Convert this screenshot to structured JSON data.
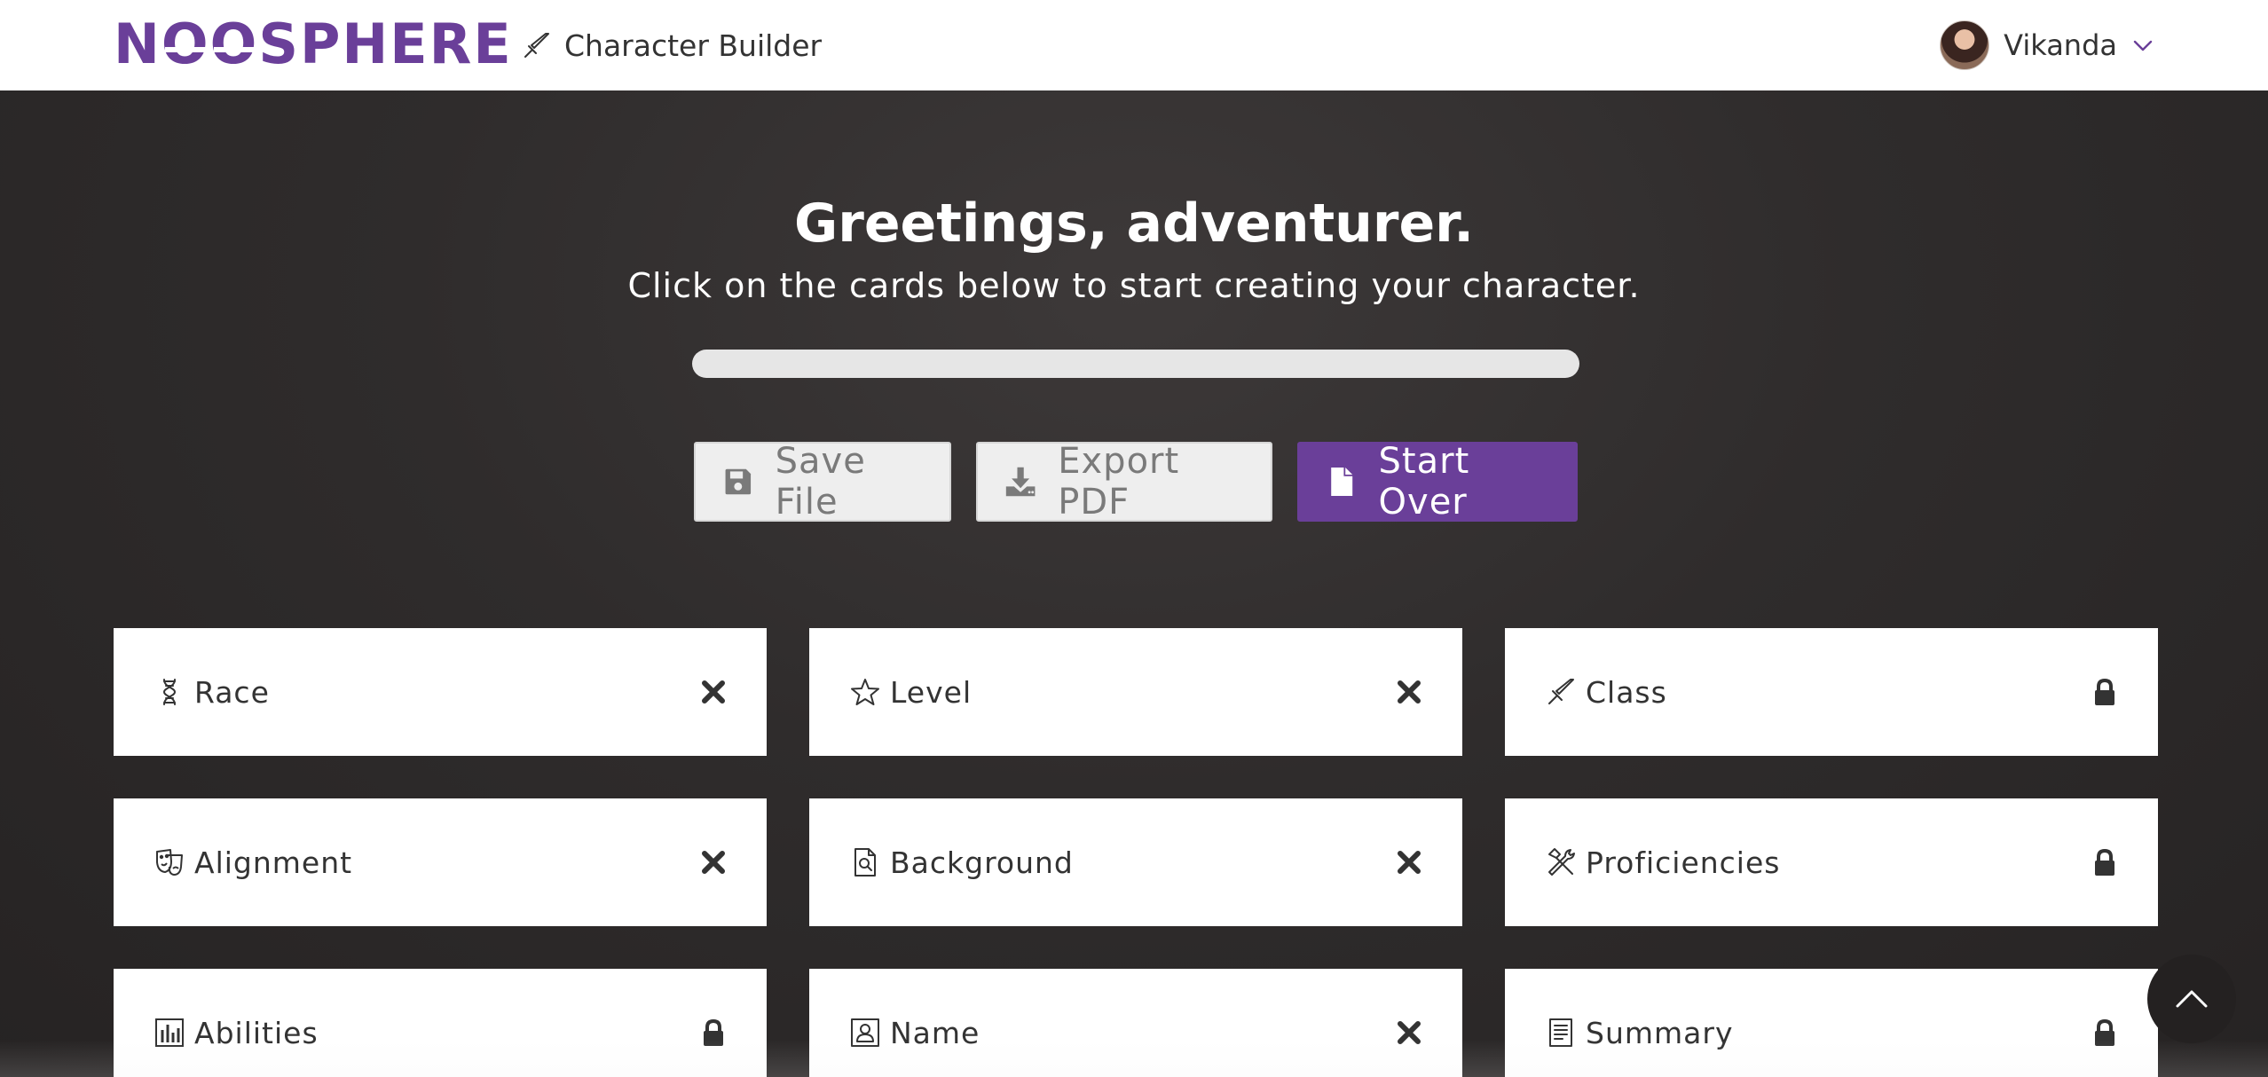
{
  "header": {
    "logo": "NOOSPHERE",
    "app_name": "Character Builder",
    "user_name": "Vikanda"
  },
  "hero": {
    "title": "Greetings, adventurer.",
    "subtitle": "Click on the cards below to start creating your character.",
    "progress_fraction": 0
  },
  "actions": {
    "save_label": "Save File",
    "export_label": "Export PDF",
    "start_over_label": "Start Over"
  },
  "cards": [
    {
      "label": "Race",
      "icon": "dna-icon",
      "state": "close"
    },
    {
      "label": "Level",
      "icon": "star-icon",
      "state": "close"
    },
    {
      "label": "Class",
      "icon": "dagger-icon",
      "state": "lock"
    },
    {
      "label": "Alignment",
      "icon": "theater-masks-icon",
      "state": "close"
    },
    {
      "label": "Background",
      "icon": "file-search-icon",
      "state": "close"
    },
    {
      "label": "Proficiencies",
      "icon": "tools-icon",
      "state": "lock"
    },
    {
      "label": "Abilities",
      "icon": "bar-chart-icon",
      "state": "lock"
    },
    {
      "label": "Name",
      "icon": "id-card-icon",
      "state": "close"
    },
    {
      "label": "Summary",
      "icon": "document-icon",
      "state": "lock"
    }
  ],
  "colors": {
    "brand": "#6a3f99",
    "background": "#2e2b2b",
    "card": "#ffffff"
  }
}
